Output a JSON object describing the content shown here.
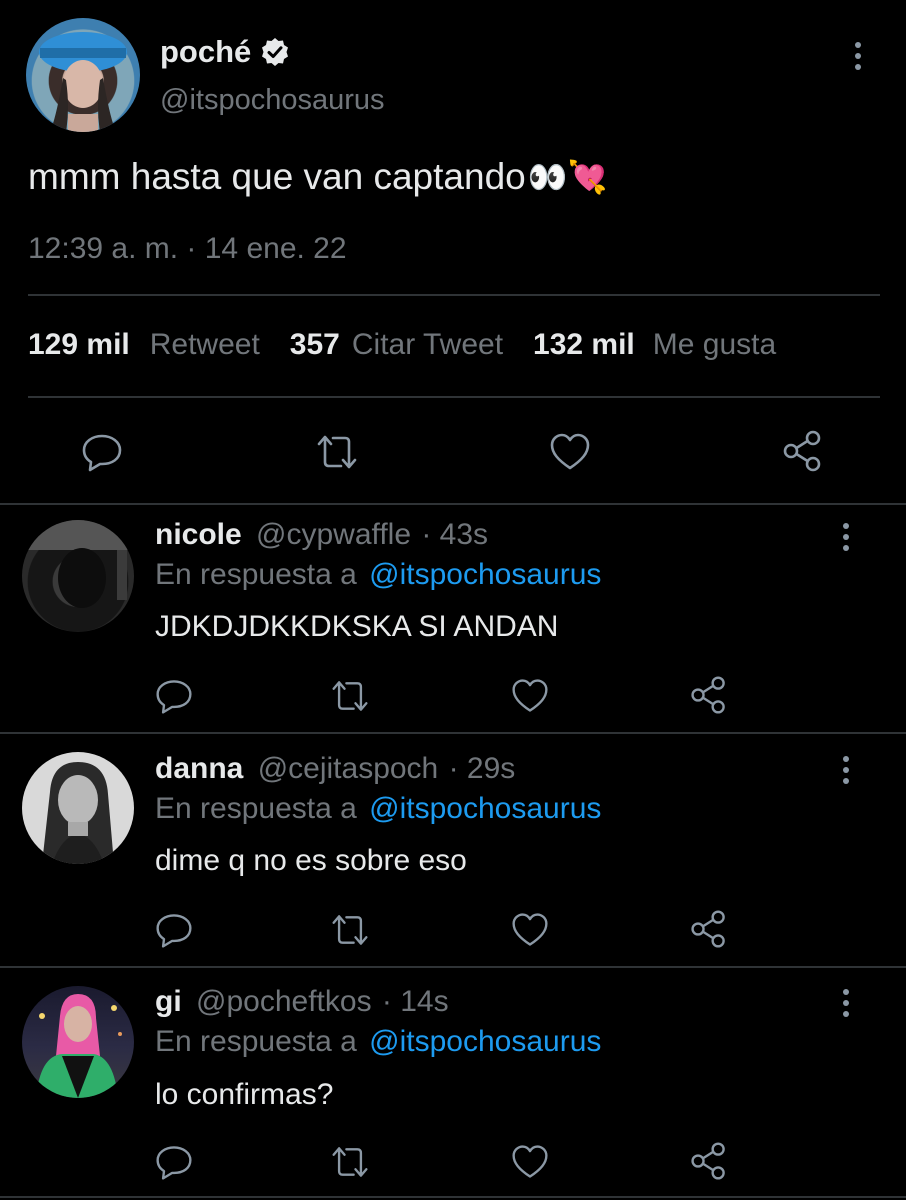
{
  "main_tweet": {
    "name": "poché",
    "handle": "@itspochosaurus",
    "text": "mmm hasta que van captando",
    "emoji": "👀💘",
    "time": "12:39 a. m. · 14 ene. 22",
    "stats": {
      "retweets_count": "129 mil",
      "retweets_label": "Retweet",
      "quotes_count": "357",
      "quotes_label": "Citar Tweet",
      "likes_count": "132 mil",
      "likes_label": "Me gusta"
    }
  },
  "replies": [
    {
      "name": "nicole",
      "handle": "@cypwaffle",
      "time": "· 43s",
      "reply_prefix": "En respuesta a",
      "reply_to": "@itspochosaurus",
      "text": "JDKDJDKKDKSKA SI ANDAN"
    },
    {
      "name": "danna",
      "handle": "@cejitaspoch",
      "time": "· 29s",
      "reply_prefix": "En respuesta a",
      "reply_to": "@itspochosaurus",
      "text": "dime q no es sobre eso"
    },
    {
      "name": "gi",
      "handle": "@pocheftkos",
      "time": "· 14s",
      "reply_prefix": "En respuesta a",
      "reply_to": "@itspochosaurus",
      "text": "lo confirmas?"
    }
  ],
  "colors": {
    "background": "#000000",
    "text": "#e7e9ea",
    "muted": "#71767b",
    "link": "#1d9bf0",
    "separator": "#2f3336"
  },
  "icons": [
    "verified-badge-icon",
    "more-options-icon",
    "reply-icon",
    "retweet-icon",
    "like-icon",
    "share-icon"
  ]
}
